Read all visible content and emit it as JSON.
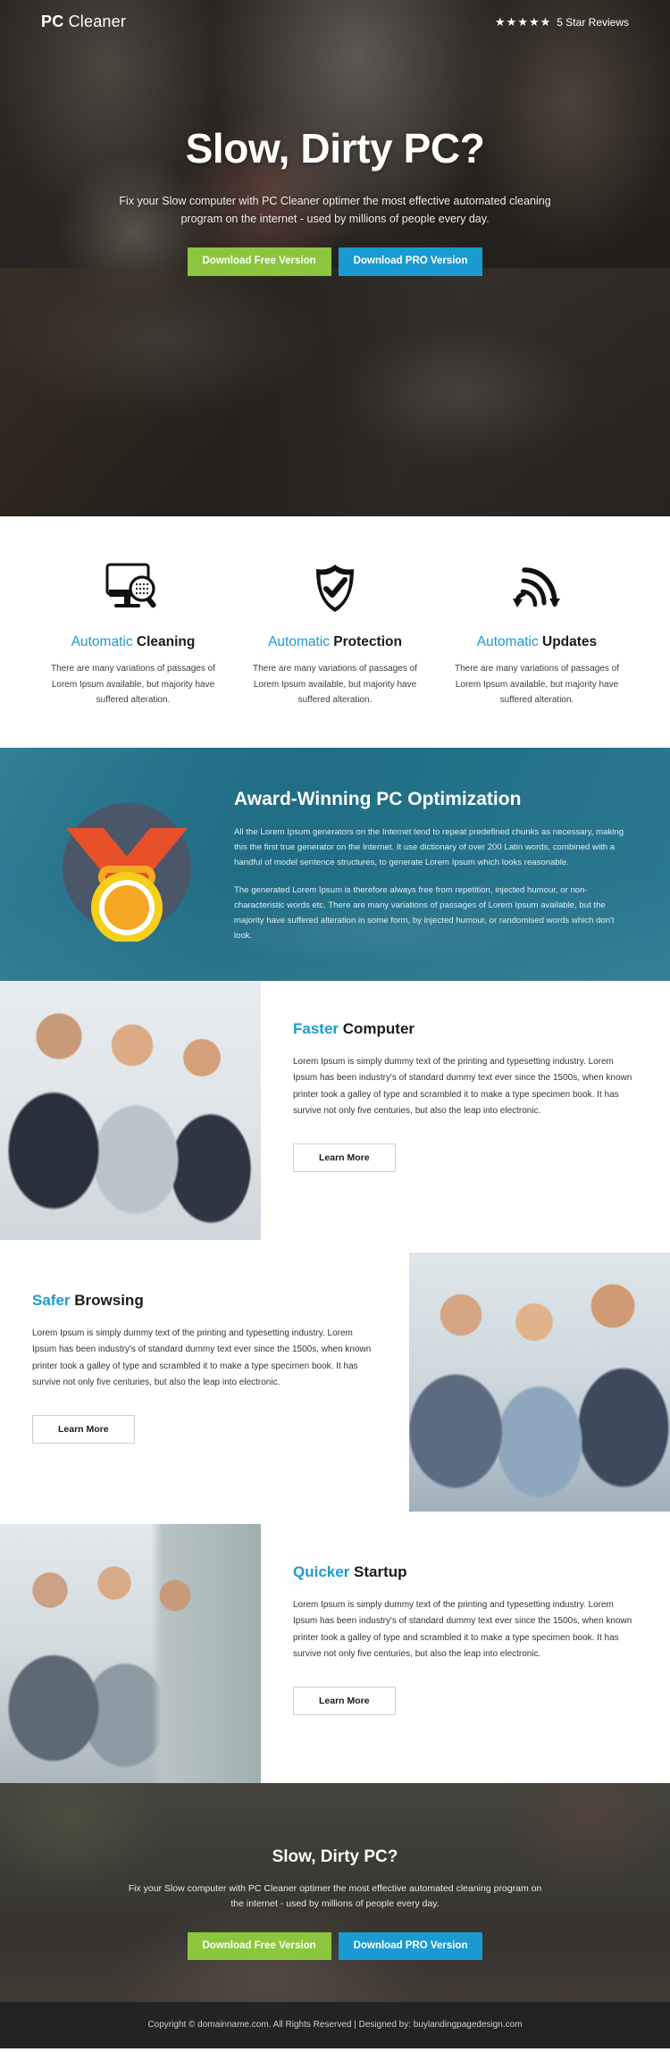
{
  "header": {
    "brand_bold": "PC",
    "brand_light": " Cleaner",
    "stars": "★★★★★",
    "reviews_label": "5 Star Reviews"
  },
  "hero": {
    "title": "Slow, Dirty PC?",
    "subtitle": "Fix your Slow computer with PC Cleaner optimer the most effective automated cleaning program on the internet - used by millions of people every day.",
    "btn_free": "Download Free Version",
    "btn_pro": "Download PRO Version"
  },
  "features": [
    {
      "icon": "monitor-magnifier-icon",
      "title_hl": "Automatic",
      "title_rest": " Cleaning",
      "text": "There are many variations of passages of Lorem Ipsum available, but majority have suffered alteration."
    },
    {
      "icon": "shield-check-icon",
      "title_hl": "Automatic",
      "title_rest": " Protection",
      "text": "There are many variations of passages of Lorem Ipsum available, but majority have suffered alteration."
    },
    {
      "icon": "refresh-signal-icon",
      "title_hl": "Automatic",
      "title_rest": " Updates",
      "text": "There are many variations of passages of Lorem Ipsum available, but majority have suffered alteration."
    }
  ],
  "award": {
    "icon": "medal-icon",
    "title": "Award-Winning PC Optimization",
    "paragraph1": "All the Lorem Ipsum generators on the Internet tend to repeat predefined chunks as necessary, making this the first true generator on the Internet. It use dictionary of over 200 Latin words, combined with a handful of model sentence structures, to generate Lorem Ipsum which looks reasonable.",
    "paragraph2": "The generated Lorem Ipsum is therefore always free from repetition, injected humour, or non-characteristic words etc. There are many variations of passages of Lorem Ipsum available, but the majority have suffered alteration in some form, by injected humour, or randomised words which don't look."
  },
  "sections": [
    {
      "title_hl": "Faster",
      "title_rest": " Computer",
      "text": "Lorem Ipsum is simply dummy text of the printing and typesetting industry. Lorem Ipsum has been industry's of standard dummy text ever since the 1500s, when known printer took a galley of type and scrambled it to make a type specimen book. It has survive not only five centuries, but also the leap into electronic.",
      "button": "Learn More",
      "image": "business-team-meeting-photo"
    },
    {
      "title_hl": "Safer",
      "title_rest": " Browsing",
      "text": "Lorem Ipsum is simply dummy text of the printing and typesetting industry. Lorem Ipsum has been industry's of standard dummy text ever since the 1500s, when known printer took a galley of type and scrambled it to make a type specimen book. It has survive not only five centuries, but also the leap into electronic.",
      "button": "Learn More",
      "image": "office-team-computers-photo"
    },
    {
      "title_hl": "Quicker",
      "title_rest": " Startup",
      "text": "Lorem Ipsum is simply dummy text of the printing and typesetting industry. Lorem Ipsum has been industry's of standard dummy text ever since the 1500s, when known printer took a galley of type and scrambled it to make a type specimen book. It has survive not only five centuries, but also the leap into electronic.",
      "button": "Learn More",
      "image": "students-computer-lab-photo"
    }
  ],
  "cta": {
    "title": "Slow, Dirty PC?",
    "subtitle": "Fix your Slow computer with PC Cleaner optimer the most effective automated cleaning program on the internet - used by millions of people every day.",
    "btn_free": "Download Free Version",
    "btn_pro": "Download PRO Version"
  },
  "footer": {
    "text": "Copyright © domainname.com. All Rights Reserved  |  Designed by: buylandingpagedesign.com"
  },
  "colors": {
    "accent_blue": "#1b9ad1",
    "green": "#8cc63e",
    "teal": "#22738c",
    "footer_bg": "#232323"
  }
}
